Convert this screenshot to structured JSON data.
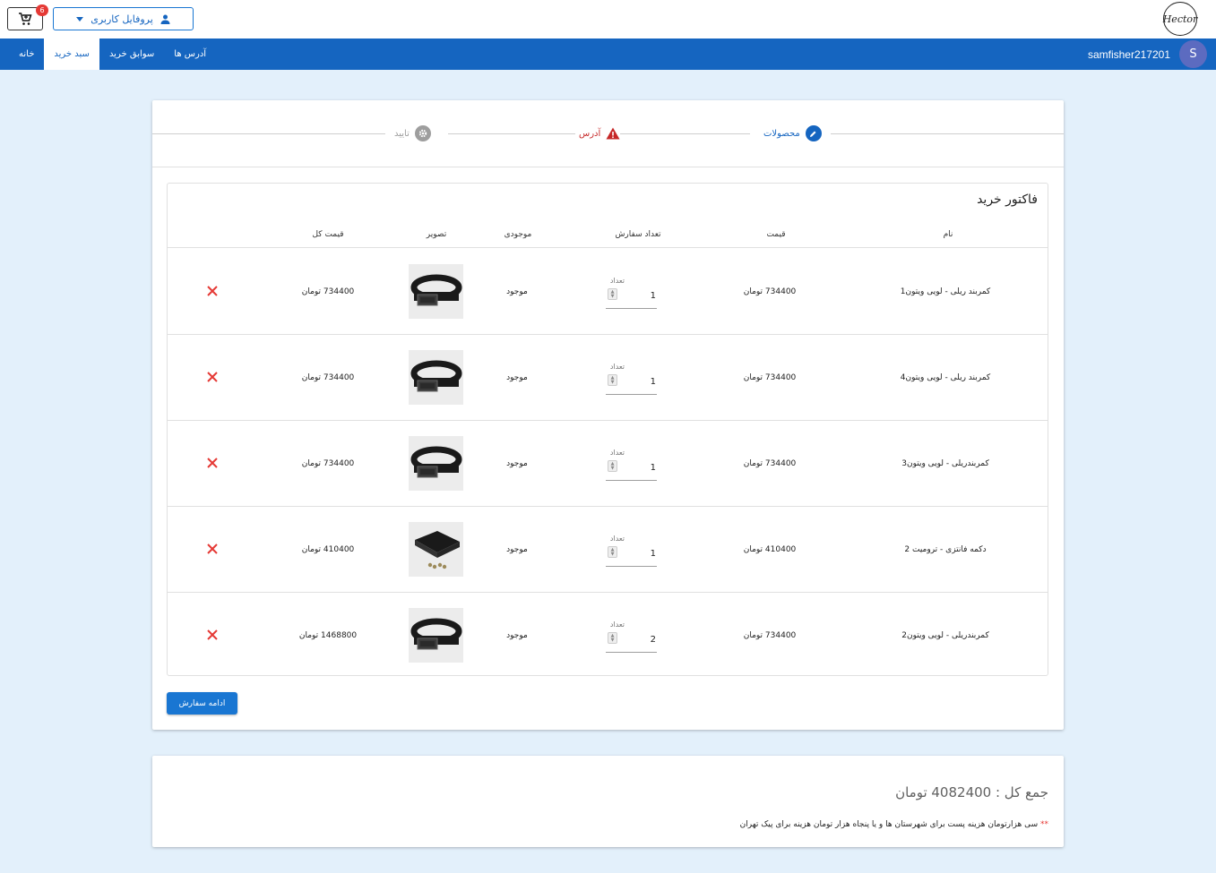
{
  "header": {
    "logo_text": "Hector",
    "cart_count": "6",
    "profile_label": "پروفایل کاربری"
  },
  "nav": {
    "tabs": [
      {
        "label": "خانه"
      },
      {
        "label": "سبد خرید"
      },
      {
        "label": "سوابق خرید"
      },
      {
        "label": "آدرس ها"
      }
    ],
    "username": "samfisher217201",
    "avatar_letter": "S"
  },
  "stepper": {
    "steps": [
      {
        "label": "محصولات",
        "status": "active",
        "color": "#1565c0"
      },
      {
        "label": "آدرس",
        "status": "error",
        "color": "#c62828"
      },
      {
        "label": "تایید",
        "status": "pending",
        "color": "#9e9e9e"
      }
    ]
  },
  "invoice": {
    "title": "فاکتور خرید",
    "columns": [
      "نام",
      "قیمت",
      "تعداد سفارش",
      "موجودی",
      "تصویر",
      "قیمت کل"
    ],
    "qty_label": "تعداد",
    "rows": [
      {
        "name": "کمربند ریلی - لویی ویتون1",
        "price": "734400 تومان",
        "qty": "1",
        "stock": "موجود",
        "total": "734400 تومان",
        "image": "belt"
      },
      {
        "name": "کمربند ریلی - لویی ویتون4",
        "price": "734400 تومان",
        "qty": "1",
        "stock": "موجود",
        "total": "734400 تومان",
        "image": "belt"
      },
      {
        "name": "کمربندریلی - لویی ویتون3",
        "price": "734400 تومان",
        "qty": "1",
        "stock": "موجود",
        "total": "734400 تومان",
        "image": "belt"
      },
      {
        "name": "دکمه فانتزی - ترومیت 2",
        "price": "410400 تومان",
        "qty": "1",
        "stock": "موجود",
        "total": "410400 تومان",
        "image": "box"
      },
      {
        "name": "کمربندریلی - لویی ویتون2",
        "price": "734400 تومان",
        "qty": "2",
        "stock": "موجود",
        "total": "1468800 تومان",
        "image": "belt"
      }
    ]
  },
  "continue_label": "ادامه سفارش",
  "summary": {
    "total_text": "جمع کل : 4082400 تومان",
    "note_stars": "**",
    "note_text": "سی هزارتومان هزینه پست برای شهرستان ها و یا پنجاه هزار تومان هزینه برای پیک تهران"
  },
  "colors": {
    "primary": "#1565c0",
    "danger": "#e53935",
    "background": "#e3f0fb"
  }
}
